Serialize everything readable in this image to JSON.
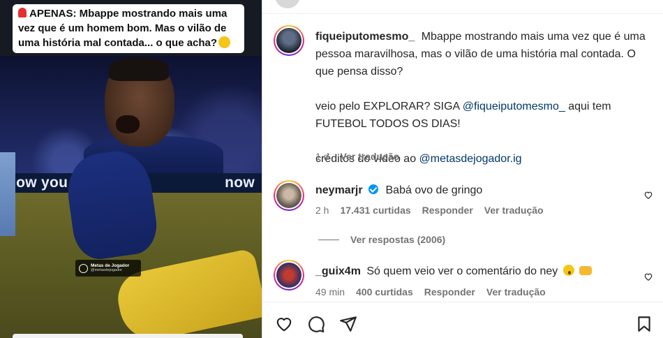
{
  "media": {
    "caption_text": "APENAS: Mbappe mostrando mais uma vez que é um homem bom. Mas o vilão de uma história mal contada... o que acha?",
    "banner_left": "now you c",
    "banner_right": "now",
    "watermark_title": "Metas de Jogador",
    "watermark_handle": "@metasdejogador"
  },
  "post": {
    "author": "fiqueiputomesmo_",
    "caption_line1": "Mbappe mostrando mais uma vez que é uma pessoa maravilhosa, mas o vilão de uma história mal contada. O que pensa disso?",
    "cta_prefix": "veio pelo EXPLORAR? SIGA",
    "cta_mention": "@fiqueiputomesmo_",
    "cta_suffix": "aqui tem FUTEBOL TODOS OS DIAS!",
    "credits_prefix": "créditos do vídeo ao",
    "credits_mention": "@metasdejogador.ig",
    "time": "1 d",
    "translate": "Ver tradução"
  },
  "comments": [
    {
      "user": "neymarjr",
      "verified": true,
      "text": "Babá ovo de gringo",
      "time": "2 h",
      "likes": "17.431 curtidas",
      "reply": "Responder",
      "translate": "Ver tradução",
      "view_replies": "Ver respostas (2006)"
    },
    {
      "user": "_guix4m",
      "verified": false,
      "text": "Só quem veio ver o comentário do ney",
      "time": "49 min",
      "likes": "400 curtidas",
      "reply": "Responder",
      "translate": "Ver tradução"
    }
  ],
  "icons": {
    "like": "heart-outline-icon",
    "comment": "comment-bubble-icon",
    "share": "paper-plane-icon",
    "save": "bookmark-icon"
  },
  "colors": {
    "mention": "#00376b",
    "verified": "#0095f6",
    "muted": "#737373"
  }
}
